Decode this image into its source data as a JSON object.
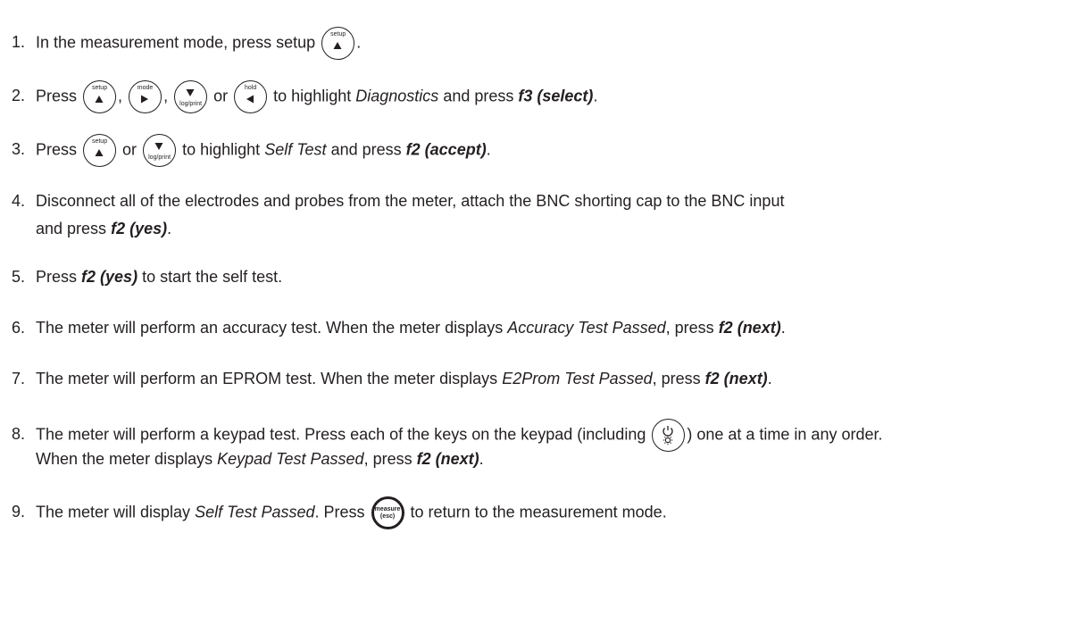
{
  "steps": [
    {
      "num": "1.",
      "t1": "In the measurement mode, press setup",
      "t2": "."
    },
    {
      "num": "2.",
      "t1": "Press",
      "sep1": ",",
      "sep2": ",",
      "sep3": "or",
      "t2": "to highlight",
      "em1": "Diagnostics",
      "t3": "and press",
      "strong1": "f3 (select)",
      "t4": "."
    },
    {
      "num": "3.",
      "t1": "Press",
      "sep1": "or",
      "t2": "to highlight",
      "em1": "Self Test",
      "t3": "and press",
      "strong1": "f2 (accept)",
      "t4": "."
    },
    {
      "num": "4.",
      "t1": "Disconnect all of the electrodes and probes from the meter, attach the BNC shorting cap to the BNC input",
      "t2": "and press",
      "strong1": "f2 (yes)",
      "t3": "."
    },
    {
      "num": "5.",
      "t1": "Press",
      "strong1": "f2 (yes)",
      "t2": "to start the self test."
    },
    {
      "num": "6.",
      "t1": "The meter will perform an accuracy test. When the meter displays",
      "em1": "Accuracy Test Passed",
      "t2": ", press",
      "strong1": "f2 (next)",
      "t3": "."
    },
    {
      "num": "7.",
      "t1": "The meter will perform an EPROM test. When the meter displays",
      "em1": "E2Prom Test Passed",
      "t2": ", press",
      "strong1": "f2 (next)",
      "t3": "."
    },
    {
      "num": "8.",
      "t1": "The meter will perform a keypad test. Press each of the keys on the keypad (including",
      "t2": ") one at a time in any order.",
      "t3": "When the meter displays",
      "em1": "Keypad Test Passed",
      "t4": ", press",
      "strong1": "f2 (next)",
      "t5": "."
    },
    {
      "num": "9.",
      "t1": "The meter will display",
      "em1": "Self Test Passed",
      "t2": ". Press",
      "t3": "to return to the measurement mode."
    }
  ],
  "keys": {
    "setup": "setup",
    "mode": "mode",
    "log_print": "log/print",
    "hold": "hold",
    "measure": "measure",
    "esc": "(esc)"
  },
  "icons": {
    "setup": "up-triangle-icon",
    "mode": "right-triangle-icon",
    "log_print": "down-triangle-icon",
    "hold": "left-triangle-icon",
    "power": "power-light-icon"
  }
}
